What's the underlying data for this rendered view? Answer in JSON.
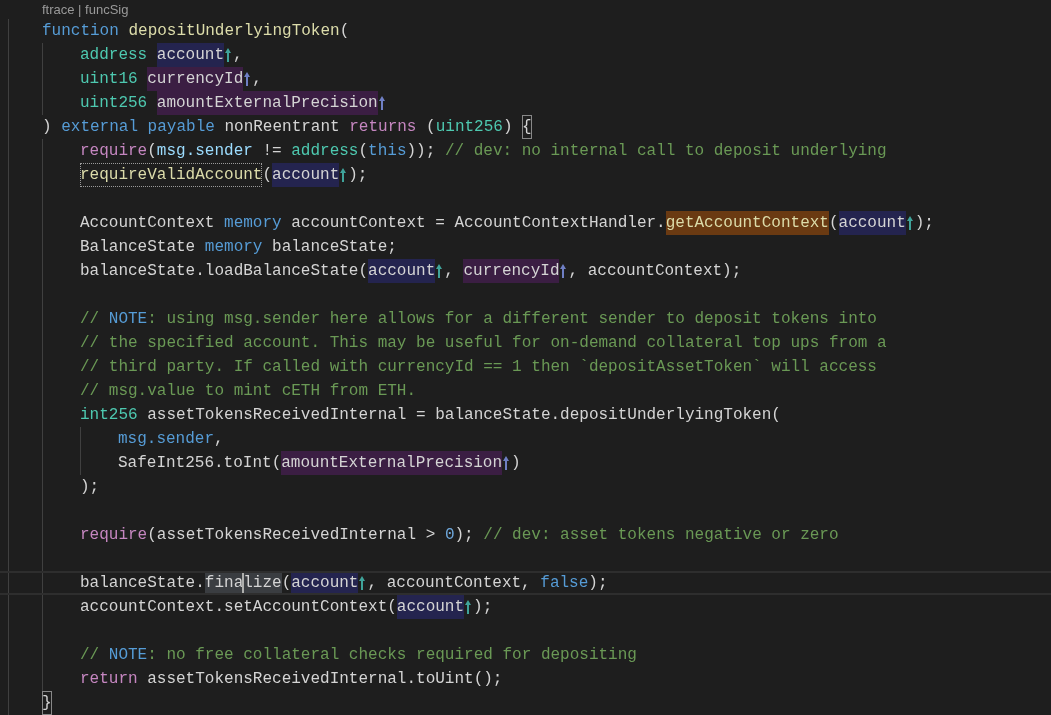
{
  "codelens": "ftrace | funcSig",
  "lines": [
    {
      "kind": "code",
      "current": false,
      "tokens": [
        {
          "text": "function ",
          "kind": "kw"
        },
        {
          "text": "depositUnderlyingToken",
          "kind": "fn"
        },
        {
          "text": "(",
          "kind": "plain"
        }
      ],
      "children": [
        {
          "kind": "code",
          "current": false,
          "tokens": [
            {
              "text": "address ",
              "kind": "type"
            },
            {
              "text": "account",
              "kind": "var-read"
            },
            {
              "kind": "marker",
              "color": "#3fa39a"
            },
            {
              "text": ",",
              "kind": "plain"
            }
          ]
        },
        {
          "kind": "code",
          "current": false,
          "tokens": [
            {
              "text": "uint16 ",
              "kind": "type"
            },
            {
              "text": "currencyId",
              "kind": "var-param"
            },
            {
              "kind": "marker",
              "color": "#6f7fc4"
            },
            {
              "text": ",",
              "kind": "plain"
            }
          ]
        },
        {
          "kind": "code",
          "current": false,
          "tokens": [
            {
              "text": "uint256 ",
              "kind": "type"
            },
            {
              "text": "amountExternalPrecision",
              "kind": "var-param"
            },
            {
              "kind": "marker",
              "color": "#6f7fc4"
            }
          ]
        }
      ]
    },
    {
      "kind": "code",
      "current": false,
      "tokens": [
        {
          "text": ") ",
          "kind": "plain"
        },
        {
          "text": "external payable",
          "kind": "kw"
        },
        {
          "text": " nonReentrant ",
          "kind": "plain"
        },
        {
          "text": "returns",
          "kind": "ctrl"
        },
        {
          "text": " (",
          "kind": "plain"
        },
        {
          "text": "uint256",
          "kind": "type"
        },
        {
          "text": ") ",
          "kind": "plain"
        },
        {
          "text": "{",
          "kind": "bracket"
        }
      ],
      "children": [
        {
          "kind": "code",
          "current": false,
          "tokens": [
            {
              "text": "require",
              "kind": "ctrl"
            },
            {
              "text": "(",
              "kind": "plain"
            },
            {
              "text": "msg.sender",
              "kind": "member"
            },
            {
              "text": " != ",
              "kind": "plain"
            },
            {
              "text": "address",
              "kind": "type"
            },
            {
              "text": "(",
              "kind": "plain"
            },
            {
              "text": "this",
              "kind": "kw"
            },
            {
              "text": ")); ",
              "kind": "plain"
            },
            {
              "text": "// dev: no internal call to deposit underlying",
              "kind": "comment"
            }
          ]
        },
        {
          "kind": "code",
          "current": false,
          "tokens": [
            {
              "text": "requireValidAccount",
              "kind": "fn-focus"
            },
            {
              "text": "(",
              "kind": "plain"
            },
            {
              "text": "account",
              "kind": "var-read"
            },
            {
              "kind": "marker",
              "color": "#3fa39a"
            },
            {
              "text": ");",
              "kind": "plain"
            }
          ]
        },
        {
          "kind": "blank"
        },
        {
          "kind": "code",
          "current": false,
          "tokens": [
            {
              "text": "AccountContext ",
              "kind": "plain"
            },
            {
              "text": "memory",
              "kind": "kw"
            },
            {
              "text": " accountContext = AccountContextHandler.",
              "kind": "plain"
            },
            {
              "text": "getAccountContext",
              "kind": "fn-def"
            },
            {
              "text": "(",
              "kind": "plain"
            },
            {
              "text": "account",
              "kind": "var-read"
            },
            {
              "kind": "marker",
              "color": "#3fa39a"
            },
            {
              "text": ");",
              "kind": "plain"
            }
          ]
        },
        {
          "kind": "code",
          "current": false,
          "tokens": [
            {
              "text": "BalanceState ",
              "kind": "plain"
            },
            {
              "text": "memory",
              "kind": "kw"
            },
            {
              "text": " balanceState;",
              "kind": "plain"
            }
          ]
        },
        {
          "kind": "code",
          "current": false,
          "tokens": [
            {
              "text": "balanceState.loadBalanceState(",
              "kind": "plain"
            },
            {
              "text": "account",
              "kind": "var-read"
            },
            {
              "kind": "marker",
              "color": "#3fa39a"
            },
            {
              "text": ", ",
              "kind": "plain"
            },
            {
              "text": "currencyId",
              "kind": "var-param"
            },
            {
              "kind": "marker",
              "color": "#6f7fc4"
            },
            {
              "text": ", accountContext);",
              "kind": "plain"
            }
          ]
        },
        {
          "kind": "blank"
        },
        {
          "kind": "code",
          "current": false,
          "tokens": [
            {
              "text": "// ",
              "kind": "comment"
            },
            {
              "text": "NOTE",
              "kind": "kw"
            },
            {
              "text": ": using msg.sender here allows for a different sender to deposit tokens into",
              "kind": "comment"
            }
          ]
        },
        {
          "kind": "code",
          "current": false,
          "tokens": [
            {
              "text": "// the specified account. This may be useful for on-demand collateral top ups from a",
              "kind": "comment"
            }
          ]
        },
        {
          "kind": "code",
          "current": false,
          "tokens": [
            {
              "text": "// third party. If called with currencyId == 1 then `depositAssetToken` will access",
              "kind": "comment"
            }
          ]
        },
        {
          "kind": "code",
          "current": false,
          "tokens": [
            {
              "text": "// msg.value to mint cETH from ETH.",
              "kind": "comment"
            }
          ]
        },
        {
          "kind": "code",
          "current": false,
          "tokens": [
            {
              "text": "int256",
              "kind": "type"
            },
            {
              "text": " assetTokensReceivedInternal = balanceState.depositUnderlyingToken(",
              "kind": "plain"
            }
          ],
          "children": [
            {
              "kind": "code",
              "current": false,
              "tokens": [
                {
                  "text": "msg.sender",
                  "kind": "kw"
                },
                {
                  "text": ",",
                  "kind": "plain"
                }
              ]
            },
            {
              "kind": "code",
              "current": false,
              "tokens": [
                {
                  "text": "SafeInt256.toInt(",
                  "kind": "plain"
                },
                {
                  "text": "amountExternalPrecision",
                  "kind": "var-param"
                },
                {
                  "kind": "marker",
                  "color": "#6f7fc4"
                },
                {
                  "text": ")",
                  "kind": "plain"
                }
              ]
            }
          ]
        },
        {
          "kind": "code",
          "current": false,
          "tokens": [
            {
              "text": ");",
              "kind": "plain"
            }
          ]
        },
        {
          "kind": "blank"
        },
        {
          "kind": "code",
          "current": false,
          "tokens": [
            {
              "text": "require",
              "kind": "ctrl"
            },
            {
              "text": "(assetTokensReceivedInternal > ",
              "kind": "plain"
            },
            {
              "text": "0",
              "kind": "num"
            },
            {
              "text": "); ",
              "kind": "plain"
            },
            {
              "text": "// dev: asset tokens negative or zero",
              "kind": "comment"
            }
          ]
        },
        {
          "kind": "blank"
        },
        {
          "kind": "code",
          "current": true,
          "tokens": [
            {
              "text": "balanceState.",
              "kind": "plain"
            },
            {
              "text": "fina",
              "kind": "word"
            },
            {
              "kind": "caret"
            },
            {
              "text": "lize",
              "kind": "word"
            },
            {
              "text": "(",
              "kind": "plain"
            },
            {
              "text": "account",
              "kind": "var-read"
            },
            {
              "kind": "marker",
              "color": "#3fa39a"
            },
            {
              "text": ", accountContext, ",
              "kind": "plain"
            },
            {
              "text": "false",
              "kind": "kw"
            },
            {
              "text": ");",
              "kind": "plain"
            }
          ]
        },
        {
          "kind": "code",
          "current": false,
          "tokens": [
            {
              "text": "accountContext.setAccountContext(",
              "kind": "plain"
            },
            {
              "text": "account",
              "kind": "var-read"
            },
            {
              "kind": "marker",
              "color": "#3fa39a"
            },
            {
              "text": ");",
              "kind": "plain"
            }
          ]
        },
        {
          "kind": "blank"
        },
        {
          "kind": "code",
          "current": false,
          "tokens": [
            {
              "text": "// ",
              "kind": "comment"
            },
            {
              "text": "NOTE",
              "kind": "kw"
            },
            {
              "text": ": no free collateral checks required for depositing",
              "kind": "comment"
            }
          ]
        },
        {
          "kind": "code",
          "current": false,
          "tokens": [
            {
              "text": "return",
              "kind": "ctrl"
            },
            {
              "text": " assetTokensReceivedInternal.toUint();",
              "kind": "plain"
            }
          ]
        }
      ]
    },
    {
      "kind": "code",
      "current": false,
      "tokens": [
        {
          "text": "}",
          "kind": "bracket"
        }
      ]
    }
  ]
}
